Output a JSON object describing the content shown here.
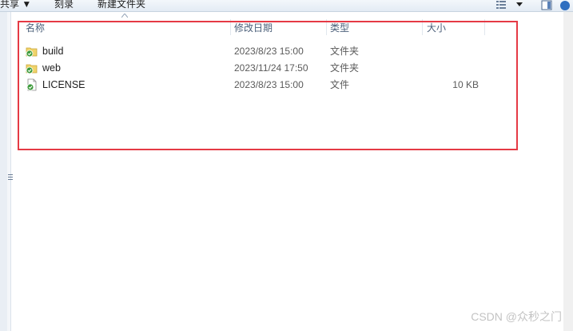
{
  "toolbar": {
    "share_label": "共享 ▼",
    "burn_label": "刻录",
    "new_folder_label": "新建文件夹"
  },
  "icons": {
    "view": "view-options-icon",
    "view_dropdown": "chevron-down-icon",
    "preview_pane": "preview-pane-icon",
    "help": "help-icon",
    "folder": "folder-icon",
    "file": "file-icon",
    "sort": "sort-up-arrow-icon"
  },
  "columns": {
    "name": "名称",
    "date": "修改日期",
    "type": "类型",
    "size": "大小"
  },
  "files": [
    {
      "name": "build",
      "date": "2023/8/23 15:00",
      "type": "文件夹",
      "size": "",
      "kind": "folder"
    },
    {
      "name": "web",
      "date": "2023/11/24 17:50",
      "type": "文件夹",
      "size": "",
      "kind": "folder"
    },
    {
      "name": "LICENSE",
      "date": "2023/8/23 15:00",
      "type": "文件",
      "size": "10 KB",
      "kind": "file"
    }
  ],
  "highlight_color": "#e53a45",
  "watermark": "CSDN @众秒之门"
}
